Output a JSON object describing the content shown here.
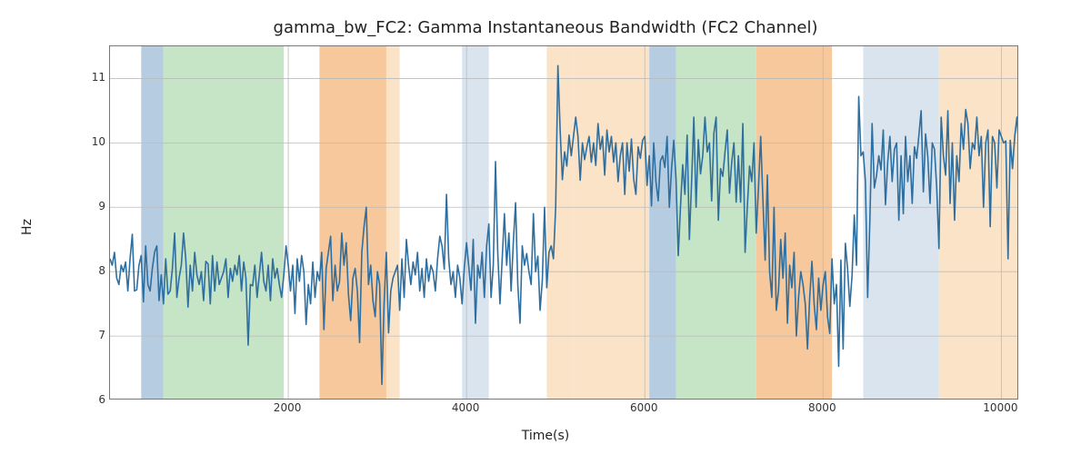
{
  "chart_data": {
    "type": "line",
    "title": "gamma_bw_FC2: Gamma Instantaneous Bandwidth (FC2 Channel)",
    "xlabel": "Time(s)",
    "ylabel": "Hz",
    "xlim": [
      0,
      10200
    ],
    "ylim": [
      6,
      11.5
    ],
    "xticks": [
      2000,
      4000,
      6000,
      8000,
      10000
    ],
    "yticks": [
      6,
      7,
      8,
      9,
      10,
      11
    ],
    "grid": true,
    "bands": [
      {
        "start": 350,
        "end": 600,
        "color": "#b6cde1"
      },
      {
        "start": 600,
        "end": 1950,
        "color": "#c6e4c6"
      },
      {
        "start": 2350,
        "end": 3100,
        "color": "#f6c89b"
      },
      {
        "start": 3100,
        "end": 3250,
        "color": "#fbe3c7"
      },
      {
        "start": 3950,
        "end": 4250,
        "color": "#d9e4ef"
      },
      {
        "start": 4900,
        "end": 5200,
        "color": "#fbe3c7"
      },
      {
        "start": 5200,
        "end": 6050,
        "color": "#fbe3c7"
      },
      {
        "start": 6050,
        "end": 6350,
        "color": "#b6cde1"
      },
      {
        "start": 6350,
        "end": 7250,
        "color": "#c6e4c6"
      },
      {
        "start": 7250,
        "end": 8100,
        "color": "#f6c89b"
      },
      {
        "start": 8450,
        "end": 9300,
        "color": "#d9e4ef"
      },
      {
        "start": 9300,
        "end": 10200,
        "color": "#fbe3c7"
      }
    ],
    "series": [
      {
        "name": "gamma_bw_FC2",
        "color": "#2f6f9f",
        "x_step": 25,
        "x_start": 0,
        "values": [
          8.2,
          8.1,
          8.3,
          7.9,
          7.8,
          8.1,
          8.0,
          8.15,
          7.7,
          8.2,
          8.58,
          7.7,
          7.72,
          8.1,
          8.25,
          7.53,
          8.4,
          7.8,
          7.7,
          8.05,
          8.3,
          8.4,
          7.55,
          7.95,
          7.5,
          8.2,
          7.65,
          7.7,
          8.05,
          8.6,
          7.6,
          7.9,
          8.1,
          8.6,
          8.2,
          7.45,
          8.1,
          7.7,
          8.3,
          7.95,
          7.8,
          8.0,
          7.55,
          8.16,
          8.12,
          7.5,
          8.25,
          7.7,
          8.15,
          7.8,
          7.9,
          8.0,
          8.2,
          7.6,
          8.05,
          7.85,
          8.1,
          7.95,
          8.25,
          7.7,
          8.15,
          7.9,
          6.86,
          7.8,
          7.78,
          8.1,
          7.6,
          7.95,
          8.3,
          7.85,
          7.7,
          8.1,
          7.55,
          8.2,
          7.9,
          8.05,
          7.8,
          7.6,
          7.95,
          8.4,
          8.1,
          7.7,
          8.1,
          7.35,
          8.2,
          7.85,
          8.25,
          8.0,
          7.18,
          7.8,
          7.5,
          8.15,
          7.6,
          8.0,
          7.86,
          8.3,
          7.1,
          8.05,
          8.3,
          8.55,
          7.55,
          8.1,
          7.7,
          7.85,
          8.6,
          8.1,
          8.45,
          7.65,
          7.24,
          7.9,
          8.05,
          7.7,
          6.9,
          8.3,
          8.7,
          9.0,
          7.8,
          8.1,
          7.55,
          7.3,
          8.0,
          7.8,
          6.25,
          7.5,
          8.3,
          7.05,
          7.7,
          7.9,
          8.0,
          8.1,
          7.4,
          8.2,
          7.6,
          8.5,
          8.1,
          7.8,
          8.15,
          7.95,
          8.3,
          7.7,
          8.05,
          7.6,
          8.2,
          7.85,
          8.1,
          8.0,
          7.7,
          8.2,
          8.55,
          8.4,
          8.04,
          9.2,
          8.2,
          7.8,
          8.0,
          7.6,
          8.1,
          7.9,
          7.5,
          8.06,
          8.45,
          8.08,
          7.71,
          8.5,
          7.2,
          8.1,
          7.9,
          8.3,
          7.6,
          8.4,
          8.74,
          7.6,
          8.1,
          9.71,
          8.3,
          7.5,
          8.2,
          8.9,
          8.1,
          8.6,
          7.7,
          8.46,
          9.07,
          7.8,
          7.2,
          8.4,
          8.1,
          8.28,
          8.0,
          7.8,
          8.9,
          8.0,
          8.24,
          7.4,
          7.86,
          9.0,
          7.75,
          8.3,
          8.4,
          8.2,
          9.0,
          11.2,
          10.2,
          9.43,
          9.86,
          9.64,
          10.12,
          9.8,
          10.1,
          10.4,
          10.1,
          9.42,
          10.0,
          9.74,
          9.94,
          10.1,
          9.7,
          10.0,
          9.65,
          10.3,
          9.9,
          10.1,
          9.5,
          10.2,
          9.86,
          10.1,
          9.7,
          10.0,
          9.4,
          9.8,
          10.0,
          9.2,
          10.0,
          9.56,
          10.06,
          9.44,
          9.2,
          9.94,
          9.76,
          10.04,
          10.1,
          9.34,
          9.8,
          9.02,
          10.0,
          9.4,
          9.1,
          9.72,
          9.8,
          9.62,
          10.1,
          9.0,
          9.6,
          10.04,
          9.44,
          8.25,
          9.0,
          9.66,
          9.2,
          10.12,
          8.5,
          9.4,
          10.4,
          9.0,
          10.05,
          9.52,
          9.8,
          10.4,
          9.86,
          10.0,
          9.1,
          10.15,
          10.4,
          8.8,
          9.6,
          9.48,
          9.86,
          10.2,
          9.22,
          9.7,
          10.0,
          9.08,
          9.8,
          9.08,
          10.3,
          8.3,
          9.0,
          9.64,
          9.4,
          10.0,
          8.6,
          9.3,
          10.1,
          9.12,
          8.18,
          9.5,
          8.0,
          7.6,
          9.0,
          7.4,
          7.7,
          8.5,
          7.9,
          8.6,
          7.2,
          8.1,
          7.75,
          8.3,
          7.0,
          7.6,
          8.0,
          7.8,
          7.5,
          6.8,
          7.6,
          8.16,
          7.5,
          7.1,
          7.9,
          7.4,
          7.8,
          8.0,
          7.3,
          7.04,
          8.2,
          7.5,
          7.8,
          6.53,
          8.18,
          6.8,
          8.44,
          8.04,
          7.46,
          7.94,
          8.88,
          8.1,
          10.72,
          9.8,
          9.86,
          9.4,
          7.6,
          8.8,
          10.3,
          9.3,
          9.5,
          9.8,
          9.58,
          10.2,
          9.04,
          9.7,
          10.1,
          9.4,
          9.9,
          10.0,
          8.8,
          9.8,
          8.9,
          10.1,
          9.4,
          9.8,
          9.06,
          9.94,
          9.76,
          10.12,
          10.5,
          9.24,
          10.14,
          9.78,
          9.06,
          10.0,
          9.9,
          9.3,
          8.36,
          10.4,
          9.8,
          9.5,
          10.5,
          9.06,
          10.0,
          8.8,
          9.8,
          9.4,
          10.3,
          9.9,
          10.52,
          10.3,
          9.6,
          10.0,
          9.9,
          10.4,
          9.8,
          10.1,
          9.0,
          10.0,
          10.2,
          8.7,
          10.1,
          10.0,
          9.3,
          10.2,
          10.1,
          10.0,
          10.03,
          8.2,
          10.04,
          9.6,
          10.1,
          10.4,
          9.86,
          10.0,
          10.2,
          9.4,
          9.7
        ]
      }
    ]
  }
}
